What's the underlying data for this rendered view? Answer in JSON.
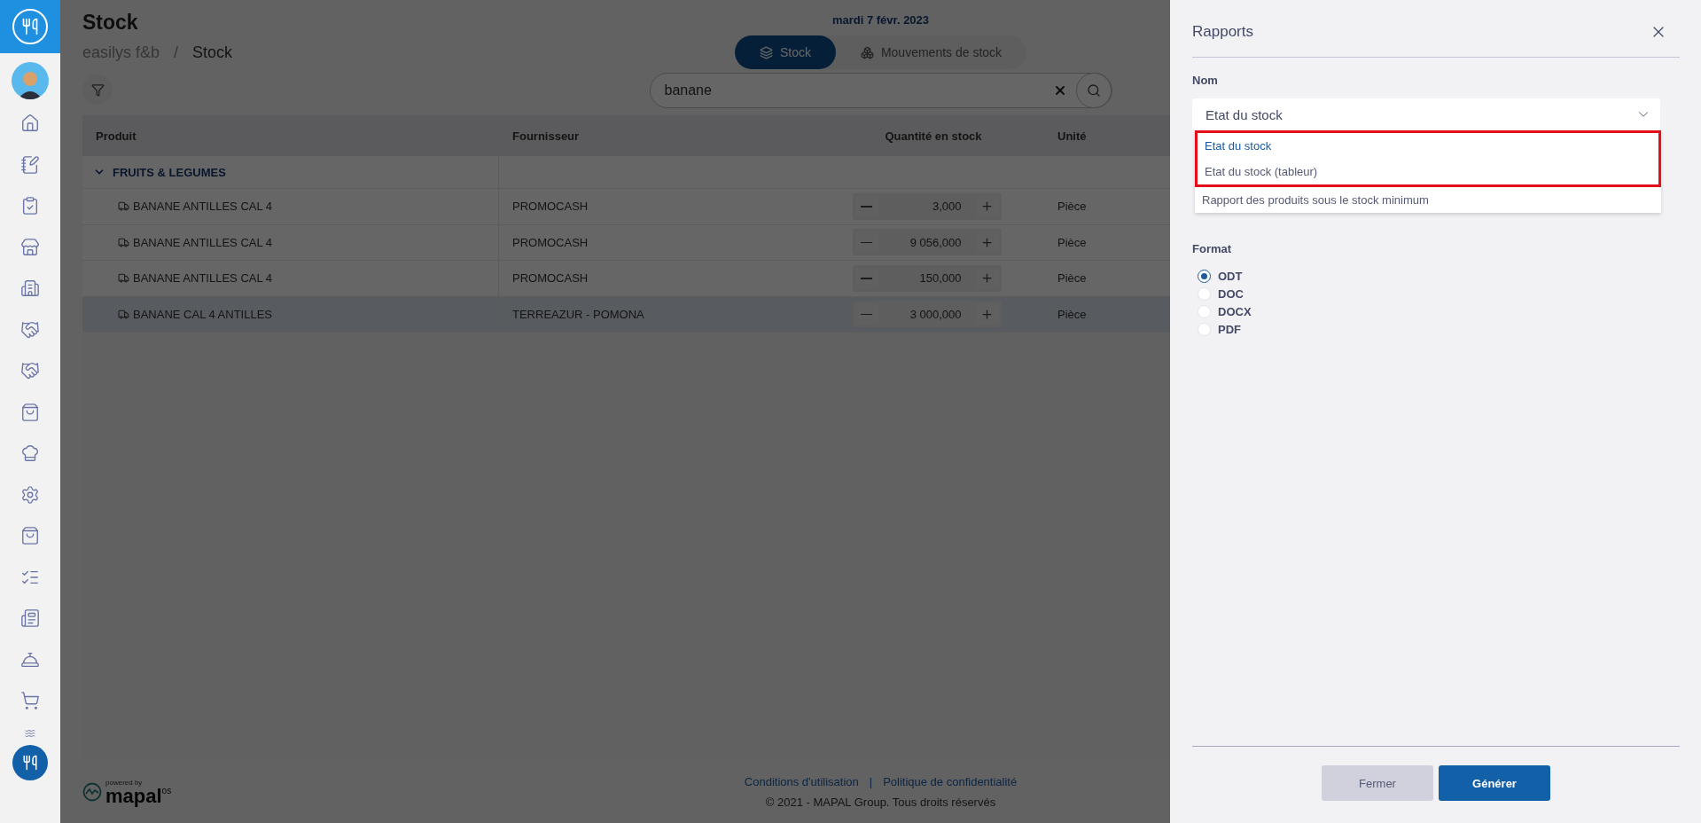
{
  "page": {
    "title": "Stock",
    "breadcrumb": [
      "easilys f&b",
      "Stock"
    ],
    "breadcrumb_separator": "/",
    "date": "mardi 7 févr. 2023"
  },
  "view_tabs": [
    {
      "label": "Stock",
      "selected": true
    },
    {
      "label": "Mouvements de stock",
      "selected": false
    }
  ],
  "search": {
    "value": "banane"
  },
  "table": {
    "columns": [
      "Produit",
      "Fournisseur",
      "Quantité en stock",
      "Unité"
    ],
    "groups": [
      {
        "name": "FRUITS & LEGUMES",
        "expanded": true,
        "rows": [
          {
            "product": "BANANE ANTILLES CAL 4",
            "supplier": "PROMOCASH",
            "quantity": "3,000",
            "unit": "Pièce",
            "selected": false
          },
          {
            "product": "BANANE ANTILLES CAL 4",
            "supplier": "PROMOCASH",
            "quantity": "9 056,000",
            "unit": "Pièce",
            "selected": false
          },
          {
            "product": "BANANE ANTILLES CAL 4",
            "supplier": "PROMOCASH",
            "quantity": "150,000",
            "unit": "Pièce",
            "selected": false
          },
          {
            "product": "BANANE CAL 4 ANTILLES",
            "supplier": "TERREAZUR - POMONA",
            "quantity": "3 000,000",
            "unit": "Pièce",
            "selected": true
          }
        ]
      }
    ]
  },
  "footer": {
    "links": [
      "Conditions d'utilisation",
      "Politique de confidentialité"
    ],
    "separator": "|",
    "copyright": "© 2021 - MAPAL Group. Tous droits réservés",
    "powered_by": "powered by",
    "brand": "mapal",
    "brand_suffix": "os"
  },
  "panel": {
    "title": "Rapports",
    "name_label": "Nom",
    "select_value": "Etat du stock",
    "options": [
      {
        "label": "Etat du stock",
        "selected": true,
        "highlighted": true
      },
      {
        "label": "Etat du stock (tableur)",
        "selected": false,
        "highlighted": true
      },
      {
        "label": "Rapport des produits sous le stock minimum",
        "selected": false,
        "highlighted": false
      }
    ],
    "format_label": "Format",
    "formats": [
      {
        "label": "ODT",
        "selected": true
      },
      {
        "label": "DOC",
        "selected": false
      },
      {
        "label": "DOCX",
        "selected": false
      },
      {
        "label": "PDF",
        "selected": false
      }
    ],
    "buttons": [
      {
        "label": "Fermer",
        "kind": "secondary"
      },
      {
        "label": "Générer",
        "kind": "primary"
      }
    ]
  }
}
